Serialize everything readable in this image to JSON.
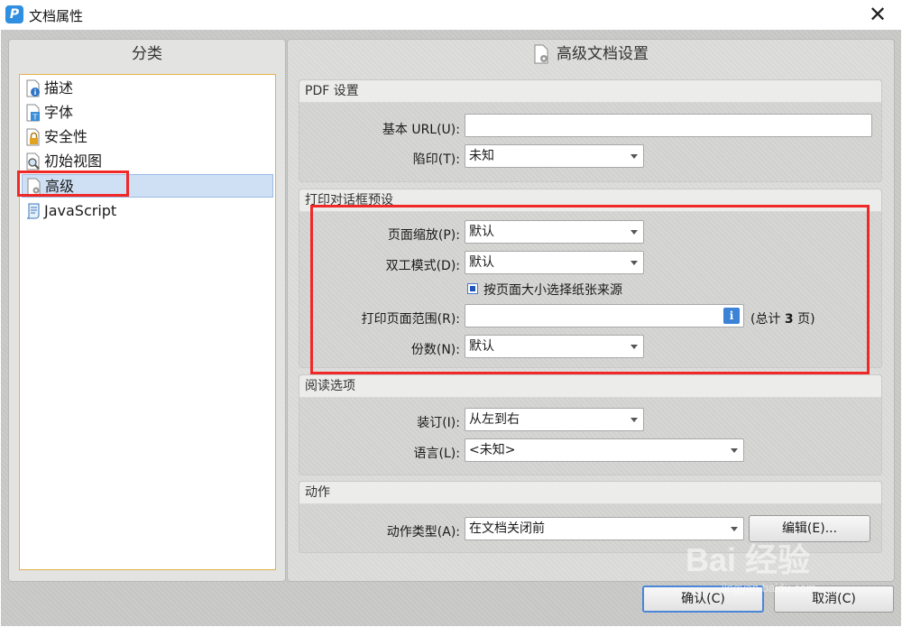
{
  "window": {
    "title": "文档属性",
    "app_icon_letter": "P",
    "close_glyph": "✕"
  },
  "left": {
    "header": "分类",
    "items": [
      {
        "label": "描述",
        "icon": "doc-info-icon"
      },
      {
        "label": "字体",
        "icon": "doc-font-icon"
      },
      {
        "label": "安全性",
        "icon": "lock-icon"
      },
      {
        "label": "初始视图",
        "icon": "magnifier-doc-icon"
      },
      {
        "label": "高级",
        "icon": "doc-gear-icon",
        "selected": true
      },
      {
        "label": "JavaScript",
        "icon": "script-icon"
      }
    ]
  },
  "right": {
    "header": "高级文档设置",
    "pdf": {
      "title": "PDF 设置",
      "base_url_label": "基本 URL(U):",
      "base_url_value": "",
      "trap_label": "陷印(T):",
      "trap_value": "未知"
    },
    "print": {
      "title": "打印对话框预设",
      "scale_label": "页面缩放(P):",
      "scale_value": "默认",
      "duplex_label": "双工模式(D):",
      "duplex_value": "默认",
      "paper_source_label": "按页面大小选择纸张来源",
      "paper_source_checked": true,
      "range_label": "打印页面范围(R):",
      "range_value": "",
      "total_prefix": "(总计 ",
      "total_pages": "3",
      "total_suffix": " 页)",
      "copies_label": "份数(N):",
      "copies_value": "默认"
    },
    "reading": {
      "title": "阅读选项",
      "binding_label": "装订(I):",
      "binding_value": "从左到右",
      "language_label": "语言(L):",
      "language_value": "<未知>"
    },
    "actions": {
      "title": "动作",
      "type_label": "动作类型(A):",
      "type_value": "在文档关闭前",
      "edit_label": "编辑(E)..."
    }
  },
  "footer": {
    "ok_label": "确认(C)",
    "cancel_label": "取消(C)"
  },
  "watermark": {
    "text": "Bai 经验",
    "sub": "jingyan.baidu.com"
  },
  "colors": {
    "highlight_red": "#f02828",
    "selection": "#cfe0f4",
    "accent_blue": "#3b83d6"
  }
}
